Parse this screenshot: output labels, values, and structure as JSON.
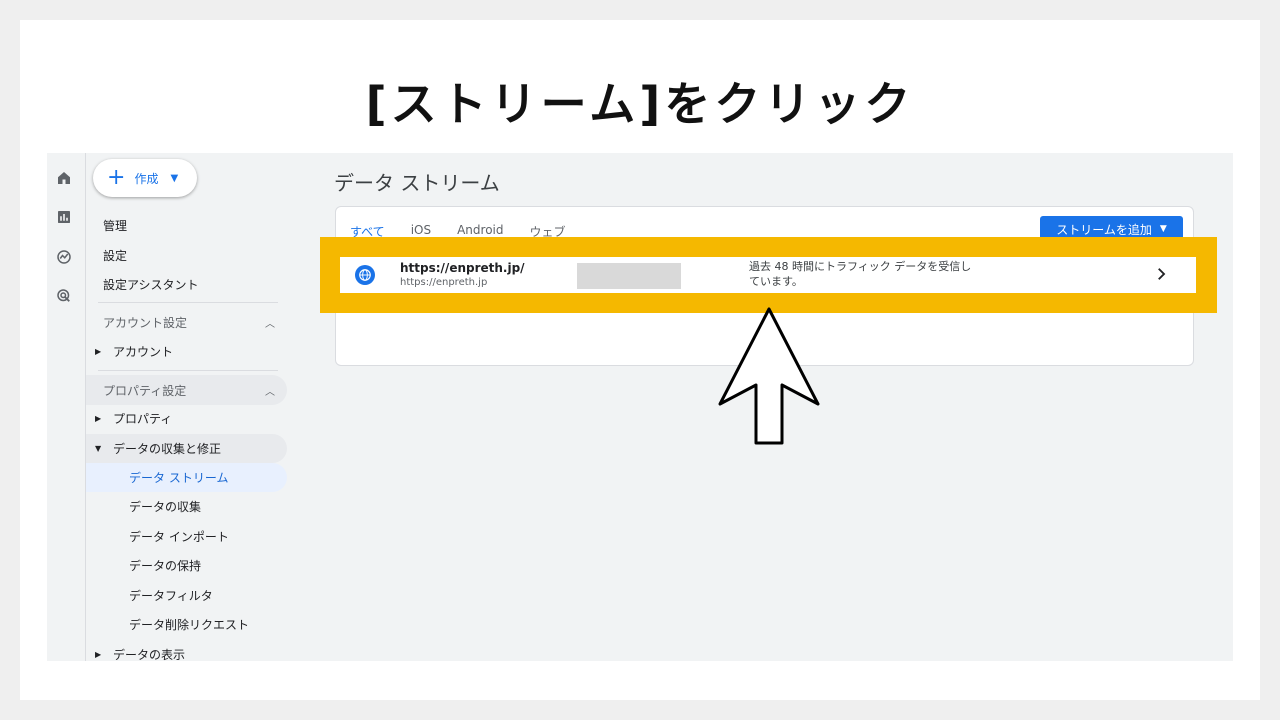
{
  "slide": {
    "title": "[ストリーム]をクリック"
  },
  "rail": {
    "icons": [
      "home-icon",
      "reports-icon",
      "explore-icon",
      "advertising-icon"
    ]
  },
  "sidebar": {
    "create_label": "作成",
    "manage_label": "管理",
    "settings_label": "設定",
    "setup_assistant_label": "設定アシスタント",
    "account_settings_label": "アカウント設定",
    "account_label": "アカウント",
    "property_settings_label": "プロパティ設定",
    "property_label": "プロパティ",
    "data_collection_modification_label": "データの収集と修正",
    "sub_items": [
      "データ ストリーム",
      "データの収集",
      "データ インポート",
      "データの保持",
      "データフィルタ",
      "データ削除リクエスト"
    ],
    "data_display_label": "データの表示"
  },
  "main": {
    "title": "データ ストリーム",
    "tabs": [
      "すべて",
      "iOS",
      "Android",
      "ウェブ"
    ],
    "active_tab_index": 0,
    "add_stream_label": "ストリームを追加",
    "stream": {
      "url_title": "https://enpreth.jp/",
      "url_sub": "https://enpreth.jp",
      "status_line1": "過去 48 時間にトラフィック データを受信し",
      "status_line2": "ています。"
    }
  },
  "colors": {
    "accent": "#1a73e8",
    "highlight": "#f5b800",
    "active_nav_bg": "#e8f0fe"
  }
}
